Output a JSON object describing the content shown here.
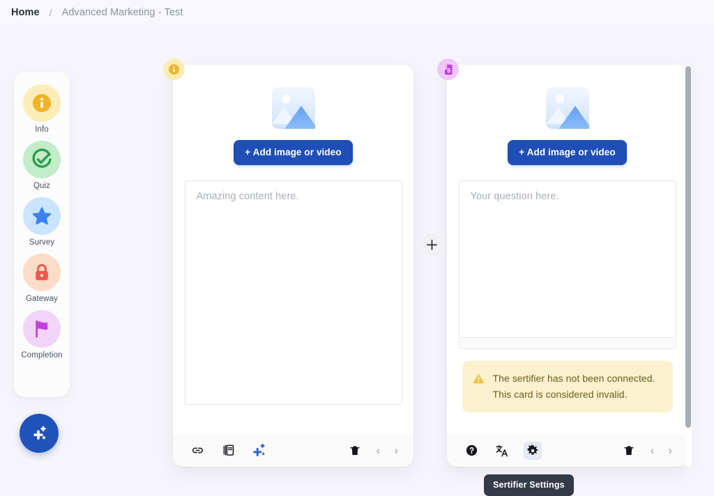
{
  "breadcrumb": {
    "home_label": "Home",
    "separator": "/",
    "current_label": "Advanced Marketing - Test"
  },
  "sidebar": {
    "items": [
      {
        "label": "Info",
        "icon": "info-icon",
        "bubble_color": "#fbedb8",
        "icon_color": "#f0b429"
      },
      {
        "label": "Quiz",
        "icon": "check-circle-icon",
        "bubble_color": "#c3ecc8",
        "icon_color": "#2e9d4f"
      },
      {
        "label": "Survey",
        "icon": "star-icon",
        "bubble_color": "#c9e4fb",
        "icon_color": "#3b82f0"
      },
      {
        "label": "Gateway",
        "icon": "lock-icon",
        "bubble_color": "#fbdcc8",
        "icon_color": "#ee5a4a"
      },
      {
        "label": "Completion",
        "icon": "flag-icon",
        "bubble_color": "#f2d4fa",
        "icon_color": "#c33fe0"
      }
    ],
    "fab": {
      "name": "add-content-sparkle-button",
      "icon": "sparkle-plus-icon",
      "color": "#2152ba"
    }
  },
  "cards": [
    {
      "badge_icon": "info-icon",
      "badge_color": "#fcecb4",
      "media_placeholder_icon": "image-placeholder-icon",
      "add_media_label": "+ Add image or video",
      "content_placeholder": "Amazing content here.",
      "toolbar": {
        "left": [
          {
            "name": "link-button",
            "icon": "link-icon",
            "label": "Add link"
          },
          {
            "name": "pdf-button",
            "icon": "pdf-icon",
            "label": "Add PDF"
          },
          {
            "name": "ai-button",
            "icon": "sparkle-plus-icon",
            "label": "AI assist"
          }
        ],
        "right": [
          {
            "name": "delete-card-button",
            "icon": "trash-icon",
            "label": "Delete"
          },
          {
            "name": "prev-card-button",
            "icon": "chevron-left-icon",
            "label": "Previous"
          },
          {
            "name": "next-card-button",
            "icon": "chevron-right-icon",
            "label": "Next"
          }
        ]
      }
    },
    {
      "badge_icon": "certificate-icon",
      "badge_color": "#f0c7f8",
      "media_placeholder_icon": "image-placeholder-icon",
      "add_media_label": "+ Add image or video",
      "content_placeholder": "Your question here.",
      "warning": {
        "icon": "warning-triangle-icon",
        "text": "The sertifier has not been connected. This card is considered invalid."
      },
      "toolbar": {
        "left": [
          {
            "name": "help-button",
            "icon": "question-circle-icon",
            "label": "Help"
          },
          {
            "name": "translate-button",
            "icon": "translate-icon",
            "label": "Translate"
          },
          {
            "name": "settings-button",
            "icon": "gear-icon",
            "label": "Sertifier Settings",
            "active": true
          }
        ],
        "right": [
          {
            "name": "delete-card-button",
            "icon": "trash-icon",
            "label": "Delete"
          },
          {
            "name": "prev-card-button",
            "icon": "chevron-left-icon",
            "label": "Previous"
          },
          {
            "name": "next-card-button",
            "icon": "chevron-right-icon",
            "label": "Next"
          }
        ]
      }
    }
  ],
  "add_card_button": {
    "name": "add-card-button",
    "icon": "plus-icon"
  },
  "tooltip": {
    "text": "Sertifier Settings"
  },
  "chevrons": {
    "left": "‹",
    "right": "›"
  },
  "colors": {
    "background": "#f6f5fb",
    "card": "#ffffff",
    "primary": "#1f4fb6",
    "warning_bg": "#fcf1ce",
    "warning_text": "#6f5a23",
    "tooltip_bg": "#343a47"
  }
}
